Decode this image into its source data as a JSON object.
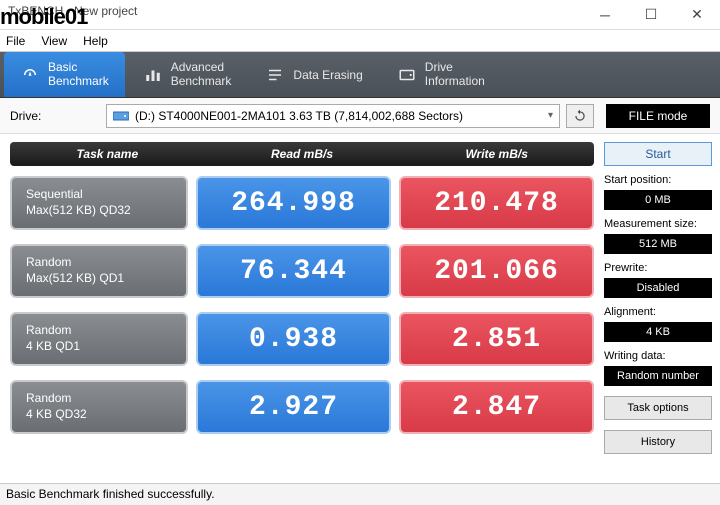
{
  "window": {
    "title": "TxBENCH - New project"
  },
  "menu": {
    "file": "File",
    "view": "View",
    "help": "Help"
  },
  "watermark": "MOBILE01",
  "tabs": {
    "basic1": "Basic",
    "basic2": "Benchmark",
    "adv1": "Advanced",
    "adv2": "Benchmark",
    "erase": "Data Erasing",
    "drive1": "Drive",
    "drive2": "Information"
  },
  "drive": {
    "label": "Drive:",
    "text": "(D:) ST4000NE001-2MA101  3.63 TB (7,814,002,688 Sectors)",
    "filemode": "FILE mode"
  },
  "headers": {
    "task": "Task name",
    "read": "Read mB/s",
    "write": "Write mB/s"
  },
  "rows": [
    {
      "name1": "Sequential",
      "name2": "Max(512 KB) QD32",
      "read": "264.998",
      "write": "210.478"
    },
    {
      "name1": "Random",
      "name2": "Max(512 KB) QD1",
      "read": "76.344",
      "write": "201.066"
    },
    {
      "name1": "Random",
      "name2": "4 KB QD1",
      "read": "0.938",
      "write": "2.851"
    },
    {
      "name1": "Random",
      "name2": "4 KB QD32",
      "read": "2.927",
      "write": "2.847"
    }
  ],
  "side": {
    "start": "Start",
    "startpos_l": "Start position:",
    "startpos_v": "0 MB",
    "meas_l": "Measurement size:",
    "meas_v": "512 MB",
    "pre_l": "Prewrite:",
    "pre_v": "Disabled",
    "align_l": "Alignment:",
    "align_v": "4 KB",
    "wdata_l": "Writing data:",
    "wdata_v": "Random number",
    "taskopt": "Task options",
    "history": "History"
  },
  "status": "Basic Benchmark finished successfully."
}
